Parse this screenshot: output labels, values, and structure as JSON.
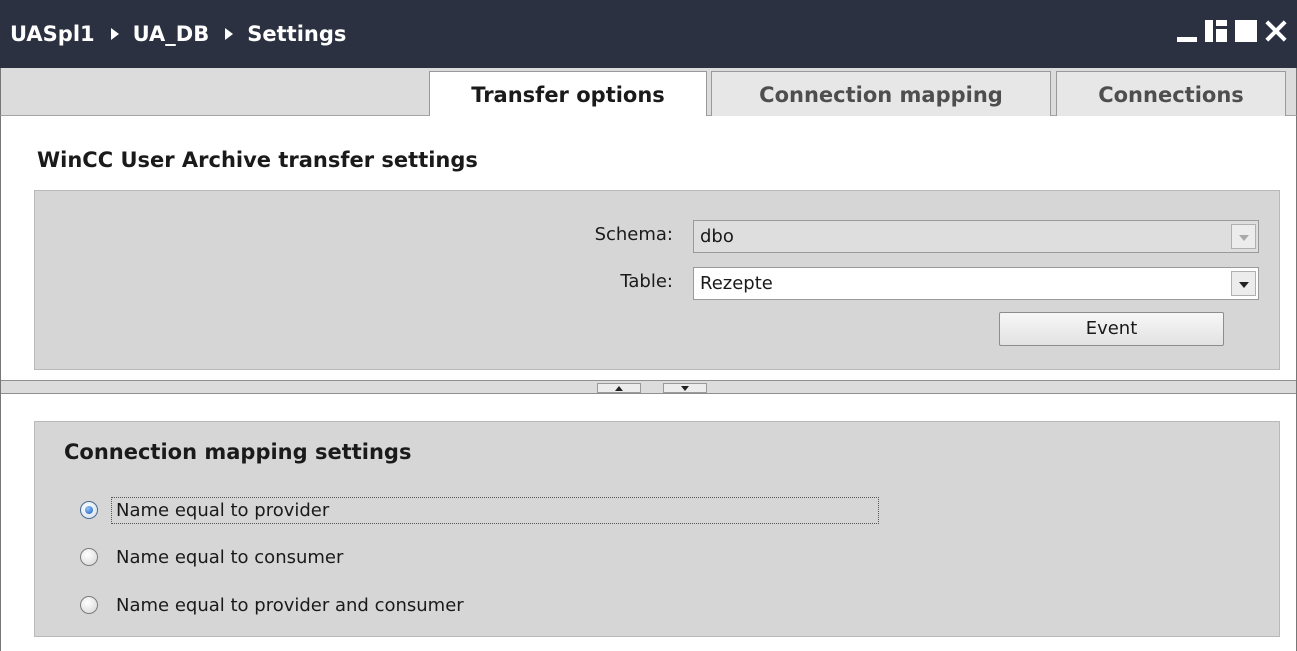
{
  "window": {
    "breadcrumbs": [
      "UASpl1",
      "UA_DB",
      "Settings"
    ],
    "controls": [
      "minimize-icon",
      "tile-icon",
      "maximize-icon",
      "close-icon"
    ]
  },
  "tabs": [
    {
      "label": "Transfer options",
      "active": true
    },
    {
      "label": "Connection mapping",
      "active": false
    },
    {
      "label": "Connections",
      "active": false
    }
  ],
  "transfer": {
    "title": "WinCC User Archive transfer settings",
    "schema_label": "Schema:",
    "schema_value": "dbo",
    "table_label": "Table:",
    "table_value": "Rezepte",
    "event_button": "Event"
  },
  "mapping": {
    "title": "Connection mapping settings",
    "options": [
      {
        "label": "Name equal to provider",
        "selected": true
      },
      {
        "label": "Name equal to consumer",
        "selected": false
      },
      {
        "label": "Name equal to provider and consumer",
        "selected": false
      }
    ]
  }
}
